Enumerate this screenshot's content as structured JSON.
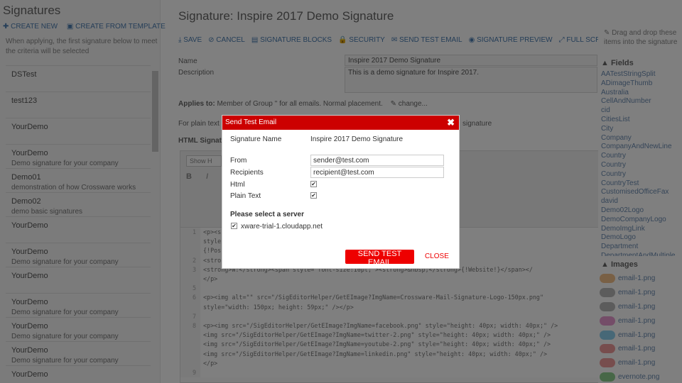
{
  "left": {
    "title": "Signatures",
    "create_new": "✚ CREATE NEW",
    "create_template": "▣ CREATE FROM TEMPLATE",
    "hint": "When applying, the first signature below to meet the criteria will be selected",
    "signatures": [
      {
        "name": "DSTest",
        "desc": ""
      },
      {
        "name": "test123",
        "desc": ""
      },
      {
        "name": "YourDemo",
        "desc": ""
      },
      {
        "name": "YourDemo",
        "desc": "Demo signature for your company"
      },
      {
        "name": "Demo01",
        "desc": "demonstration of how Crossware works"
      },
      {
        "name": "Demo02",
        "desc": "demo basic signatures"
      },
      {
        "name": "YourDemo",
        "desc": ""
      },
      {
        "name": "YourDemo",
        "desc": "Demo signature for your company"
      },
      {
        "name": "YourDemo",
        "desc": ""
      },
      {
        "name": "YourDemo",
        "desc": "Demo signature for your company"
      },
      {
        "name": "YourDemo",
        "desc": "Demo signature for your company"
      },
      {
        "name": "YourDemo",
        "desc": "Demo signature for your company"
      },
      {
        "name": "YourDemo",
        "desc": ""
      }
    ]
  },
  "main": {
    "title": "Signature: Inspire 2017 Demo Signature",
    "toolbar": [
      "⤓ SAVE",
      "⊘ CANCEL",
      "▤ SIGNATURE BLOCKS",
      "🔒 SECURITY",
      "✉ SEND TEST EMAIL",
      "◉ SIGNATURE PREVIEW",
      "⤢ FULL SCREEN"
    ],
    "name_label": "Name",
    "name_value": "Inspire 2017 Demo Signature",
    "desc_label": "Description",
    "desc_value": "This is a demo signature for Inspire 2017.",
    "applies_label": "Applies to:",
    "applies_text": "Member of Group '' for all emails. Normal placement.",
    "change": "✎ change...",
    "plain_text": "For plain text",
    "plain_tail": "signature",
    "html_sig": "HTML Signat",
    "show_html": "Show H",
    "code": [
      {
        "n": "1",
        "t": "<p><s                                                       font-size:10pt;\"><span"
      },
      {
        "n": "",
        "t": "style                                                                <br />"
      },
      {
        "n": "",
        "t": "{!Pos"
      },
      {
        "n": "2",
        "t": "<stro                                                      span><br />"
      },
      {
        "n": "3",
        "t": "<strong>W:</strong><span style=\"font-size:10pt;\"><strong>&nbsp;</strong>{!Website!}</span></"
      },
      {
        "n": "",
        "t": "</p>"
      },
      {
        "n": "5",
        "t": ""
      },
      {
        "n": "6",
        "t": "<p><img alt=\"\" src=\"/SigEditorHelper/GetEImage?ImgName=Crossware-Mail-Signature-Logo-150px.png\""
      },
      {
        "n": "",
        "t": "style=\"width: 150px; height: 59px;\" /></p>"
      },
      {
        "n": "7",
        "t": ""
      },
      {
        "n": "8",
        "t": "<p><img src=\"/SigEditorHelper/GetEImage?ImgName=facebook.png\" style=\"height: 40px; width: 40px;\" />"
      },
      {
        "n": "",
        "t": "<img src=\"/SigEditorHelper/GetEImage?ImgName=twitter-2.png\" style=\"height: 40px; width: 40px;\" />"
      },
      {
        "n": "",
        "t": "<img src=\"/SigEditorHelper/GetEImage?ImgName=youtube-2.png\" style=\"height: 40px; width: 40px;\" />"
      },
      {
        "n": "",
        "t": "<img src=\"/SigEditorHelper/GetEImage?ImgName=linkedin.png\" style=\"height: 40px; width: 40px;\" />"
      },
      {
        "n": "",
        "t": "</p>"
      },
      {
        "n": "9",
        "t": ""
      }
    ]
  },
  "right": {
    "hint": "✎ Drag and drop these\nitems into the signature",
    "fields_title": "▲ Fields",
    "fields": [
      "AATestStringSplit",
      "ADimageThumb",
      "Australia",
      "CellAndNumber",
      "cid",
      "CitiesList",
      "City",
      "Company",
      "CompanyAndNewLine",
      "Country",
      "Country",
      "Country",
      "CountryTest",
      "CustomisedOfficeFax",
      "david",
      "Demo02Logo",
      "DemoCompanyLogo",
      "DemoImgLink",
      "DemoLogo",
      "Department",
      "DepartmentAndMultiple"
    ],
    "images_title": "▲ Images",
    "images": [
      {
        "name": "email-1.png",
        "color": "#f3c08a"
      },
      {
        "name": "email-1.png",
        "color": "#b8b8b8"
      },
      {
        "name": "email-1.png",
        "color": "#b8b8b8"
      },
      {
        "name": "email-1.png",
        "color": "#e99bd0"
      },
      {
        "name": "email-1.png",
        "color": "#8fd0ef"
      },
      {
        "name": "email-1.png",
        "color": "#ee9a9a"
      },
      {
        "name": "email-1.png",
        "color": "#ee9a9a"
      },
      {
        "name": "evernote.png",
        "color": "#8fcf8f"
      }
    ]
  },
  "dialog": {
    "title": "Send Test Email",
    "close_icon": "✖",
    "sig_name_label": "Signature Name",
    "sig_name_value": "Inspire 2017 Demo Signature",
    "from_label": "From",
    "from_value": "sender@test.com",
    "recipients_label": "Recipients",
    "recipients_value": "recipient@test.com",
    "html_label": "Html",
    "plain_label": "Plain Text",
    "server_heading": "Please select a server",
    "server_name": "xware-trial-1.cloudapp.net",
    "send_button": "SEND TEST EMAIL",
    "close_button": "CLOSE",
    "accent": "#cc0000"
  }
}
